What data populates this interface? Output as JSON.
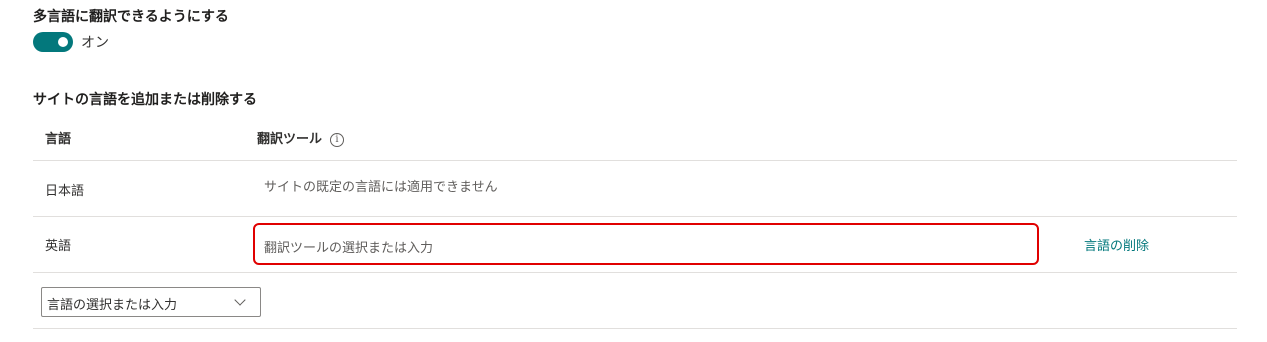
{
  "multilingual": {
    "heading": "多言語に翻訳できるようにする",
    "toggle_state": "on",
    "toggle_label": "オン",
    "accent_color": "#03787c"
  },
  "languages_section": {
    "heading": "サイトの言語を追加または削除する",
    "columns": {
      "language": "言語",
      "translator": "翻訳ツール",
      "info_icon": "info-icon"
    },
    "rows": [
      {
        "language": "日本語",
        "translator_text": "サイトの既定の言語には適用できません"
      },
      {
        "language": "英語",
        "translator_placeholder": "翻訳ツールの選択または入力",
        "remove_label": "言語の削除"
      }
    ],
    "add_language_placeholder": "言語の選択または入力"
  }
}
